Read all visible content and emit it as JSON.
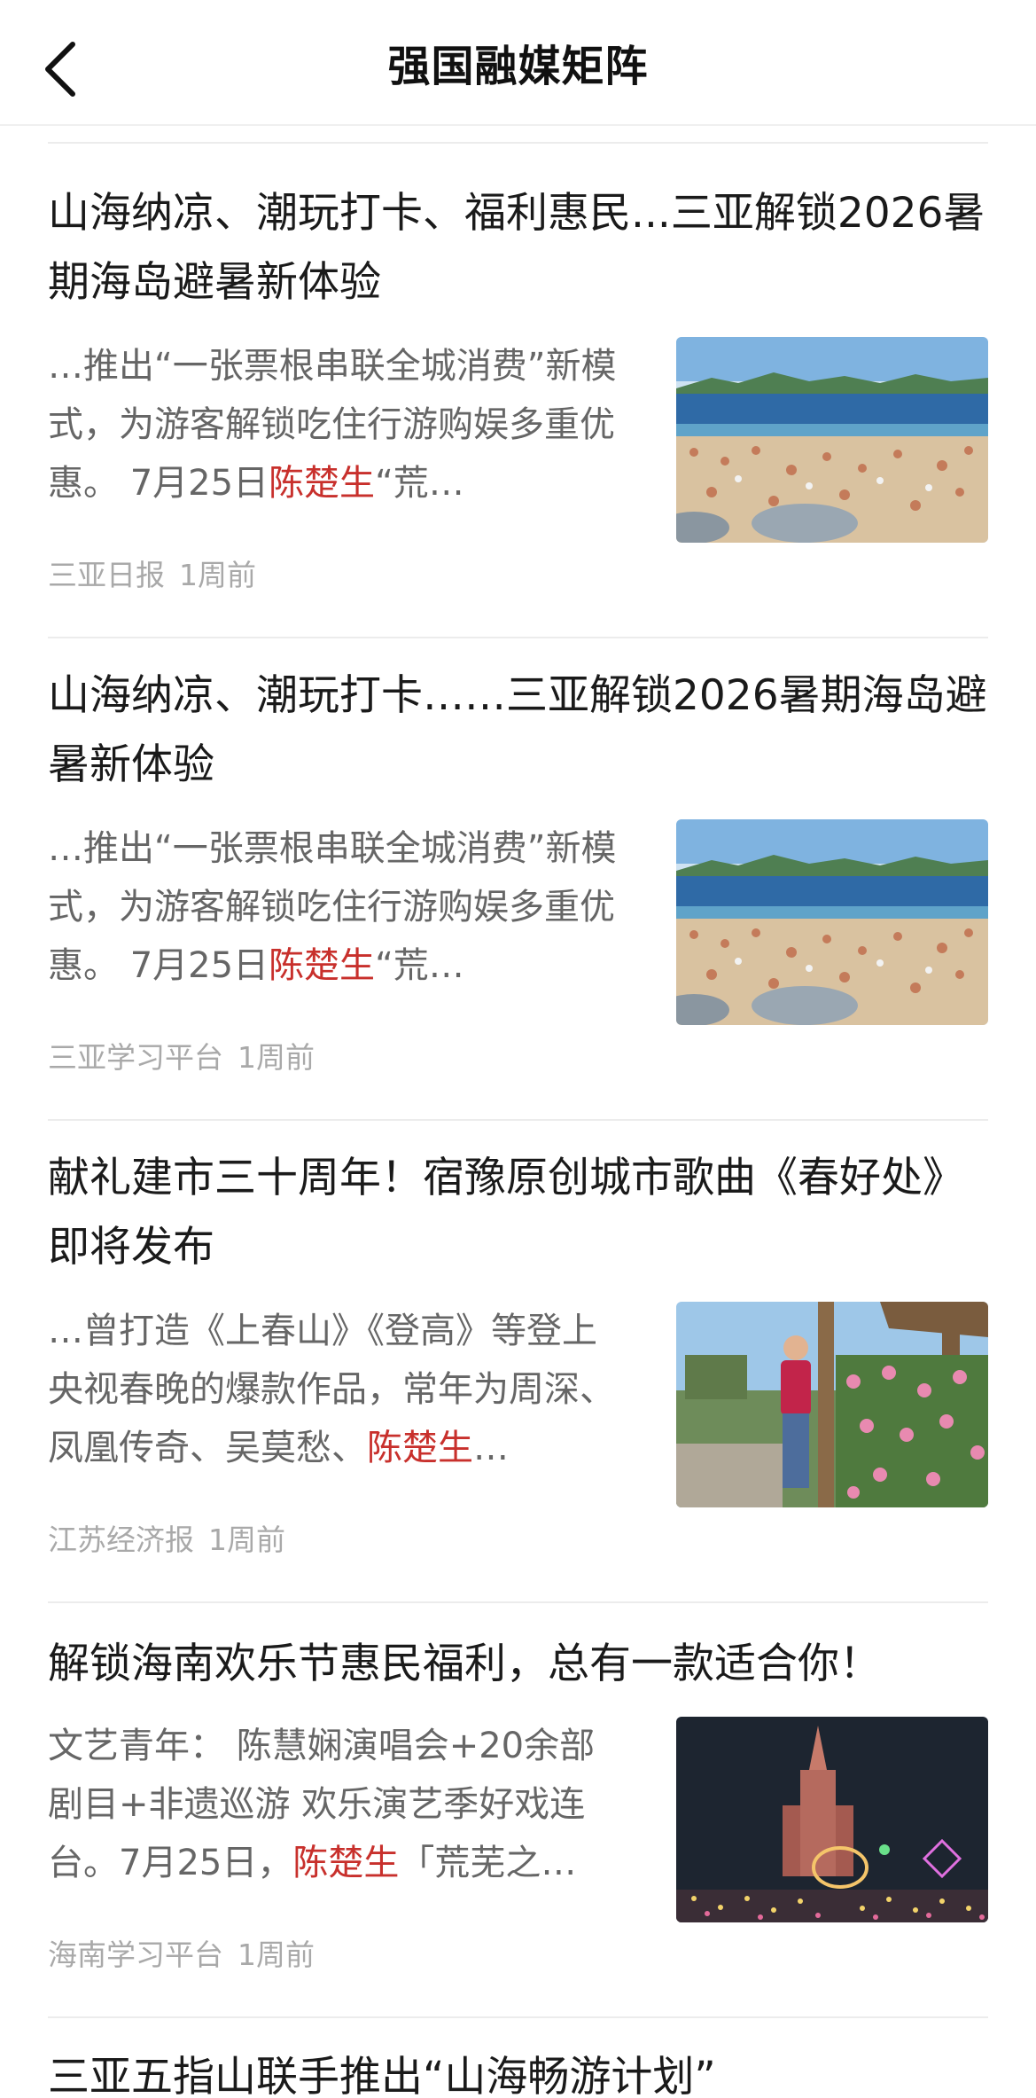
{
  "header": {
    "title": "强国融媒矩阵"
  },
  "articles": [
    {
      "title": "山海纳凉、潮玩打卡、福利惠民...三亚解锁2026暑期海岛避暑新体验",
      "snippet_before": "…推出“一张票根串联全城消费”新模式，为游客解锁吃住行游购娱多重优惠。 7月25日",
      "snippet_highlight": "陈楚生",
      "snippet_after": "“荒…",
      "source": "三亚日报",
      "time": "1周前",
      "image": "beach-crowd"
    },
    {
      "title": "山海纳凉、潮玩打卡……三亚解锁2026暑期海岛避暑新体验",
      "snippet_before": "…推出“一张票根串联全城消费”新模式，为游客解锁吃住行游购娱多重优惠。 7月25日",
      "snippet_highlight": "陈楚生",
      "snippet_after": "“荒…",
      "source": "三亚学习平台",
      "time": "1周前",
      "image": "beach-crowd"
    },
    {
      "title": "献礼建市三十周年！宿豫原创城市歌曲《春好处》即将发布",
      "snippet_before": "…曾打造《上春山》《登高》等登上央视春晚的爆款作品，常年为周深、凤凰传奇、吴莫愁、",
      "snippet_highlight": "陈楚生",
      "snippet_after": "…",
      "source": "江苏经济报",
      "time": "1周前",
      "image": "man-with-roses"
    },
    {
      "title": "解锁海南欢乐节惠民福利，总有一款适合你！",
      "snippet_before": "文艺青年： 陈慧娴演唱会+20余部剧目+非遗巡游 欢乐演艺季好戏连台。7月25日，",
      "snippet_highlight": "陈楚生",
      "snippet_after": "「荒芜之…",
      "source": "海南学习平台",
      "time": "1周前",
      "image": "night-castle-lights"
    },
    {
      "title": "三亚五指山联手推出“山海畅游计划”"
    }
  ],
  "colors": {
    "highlight": "#c8302c",
    "meta": "#a9a9a9",
    "snippet": "#666666"
  },
  "icons": {
    "back": "chevron-left-icon"
  }
}
